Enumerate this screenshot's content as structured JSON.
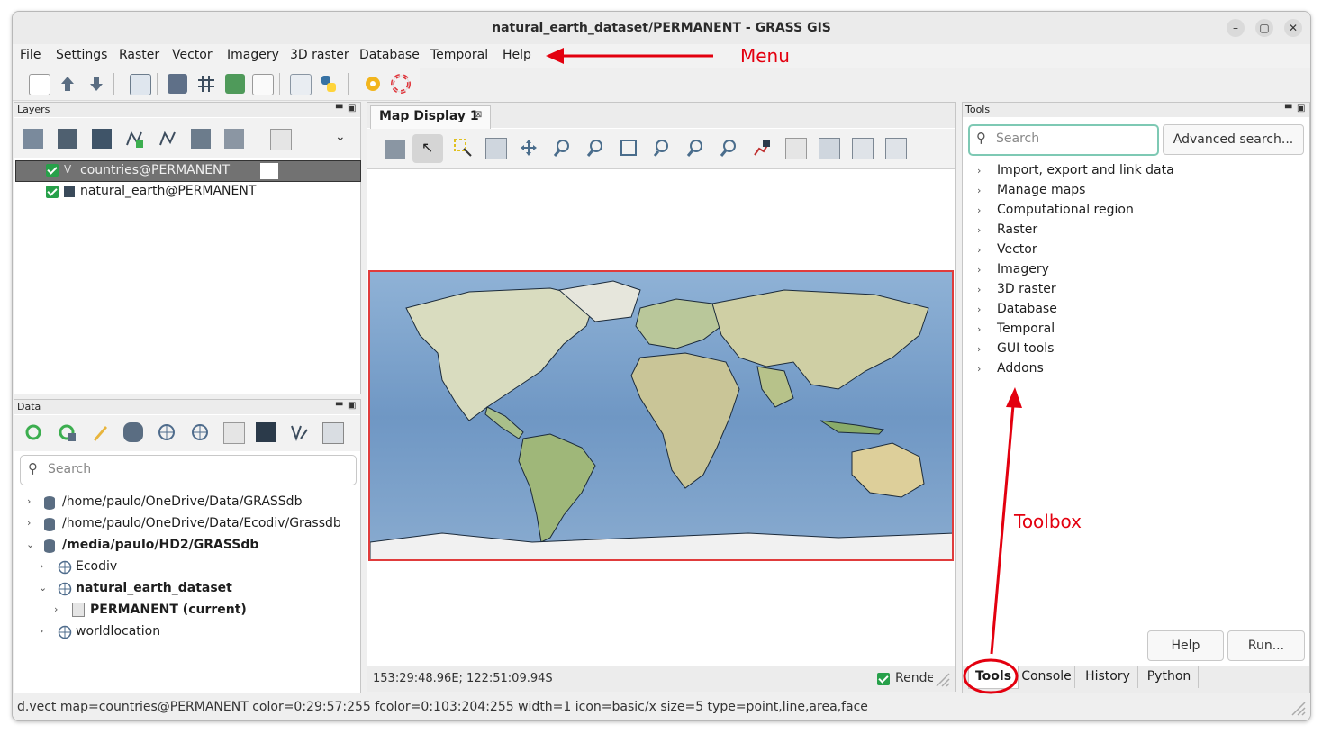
{
  "window": {
    "title": "natural_earth_dataset/PERMANENT - GRASS GIS",
    "controls": [
      "–",
      "▢",
      "✕"
    ]
  },
  "menu": {
    "items": [
      "File",
      "Settings",
      "Raster",
      "Vector",
      "Imagery",
      "3D raster",
      "Database",
      "Temporal",
      "Help"
    ]
  },
  "toolbar": {
    "icons": [
      "new-workspace-icon",
      "upload-icon",
      "download-icon",
      "new-display-icon",
      "georectifier-icon",
      "grid-icon",
      "graphical-modeler-icon",
      "cartographic-composer-icon",
      "launch-script-icon",
      "python-icon",
      "settings-icon",
      "help-icon"
    ]
  },
  "layers_panel": {
    "title": "Layers",
    "layers": [
      {
        "label": "countries@PERMANENT",
        "checked": true,
        "selected": true,
        "type": "vector"
      },
      {
        "label": "natural_earth@PERMANENT",
        "checked": true,
        "selected": false,
        "type": "raster"
      }
    ]
  },
  "data_panel": {
    "title": "Data",
    "search_placeholder": "Search",
    "tree": [
      {
        "label": "/home/paulo/OneDrive/Data/GRASSdb",
        "bold": false,
        "depth": 0,
        "icon": "database-icon"
      },
      {
        "label": "/home/paulo/OneDrive/Data/Ecodiv/Grassdb",
        "bold": false,
        "depth": 0,
        "icon": "database-icon"
      },
      {
        "label": "/media/paulo/HD2/GRASSdb",
        "bold": true,
        "depth": 0,
        "icon": "database-icon"
      },
      {
        "label": "Ecodiv",
        "bold": false,
        "depth": 1,
        "icon": "globe-icon"
      },
      {
        "label": "natural_earth_dataset",
        "bold": true,
        "depth": 1,
        "icon": "globe-icon"
      },
      {
        "label": "PERMANENT  (current)",
        "bold": true,
        "depth": 2,
        "icon": "mapset-icon"
      },
      {
        "label": "worldlocation",
        "bold": false,
        "depth": 1,
        "icon": "globe-icon"
      }
    ]
  },
  "map_display": {
    "tab_label": "Map Display 1",
    "coordinates": "153:29:48.96E; 122:51:09.94S",
    "render_label": "Render",
    "render_checked": true
  },
  "tools_panel": {
    "title": "Tools",
    "search_placeholder": "Search",
    "advanced_search_label": "Advanced search...",
    "categories": [
      "Import, export and link data",
      "Manage maps",
      "Computational region",
      "Raster",
      "Vector",
      "Imagery",
      "3D raster",
      "Database",
      "Temporal",
      "GUI tools",
      "Addons"
    ],
    "help_label": "Help",
    "run_label": "Run...",
    "tabs": [
      "Tools",
      "Console",
      "History",
      "Python"
    ],
    "active_tab": "Tools"
  },
  "statusbar": {
    "text": "d.vect map=countries@PERMANENT color=0:29:57:255 fcolor=0:103:204:255 width=1 icon=basic/x size=5 type=point,line,area,face"
  },
  "annotations": {
    "menu_label": "Menu",
    "toolbox_label": "Toolbox",
    "color": "#e3000f"
  }
}
